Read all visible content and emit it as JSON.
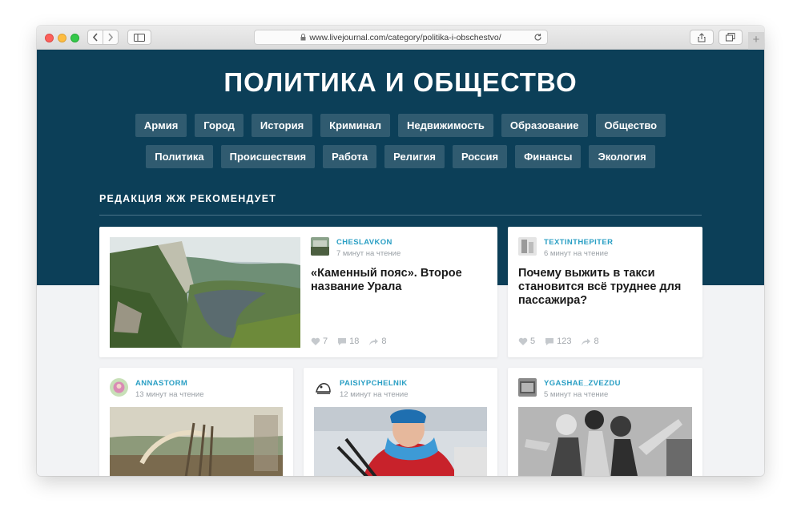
{
  "browser": {
    "url": "www.livejournal.com/category/politika-i-obschestvo/"
  },
  "page": {
    "title": "ПОЛИТИКА И ОБЩЕСТВО",
    "tags_row1": [
      "Армия",
      "Город",
      "История",
      "Криминал",
      "Недвижимость",
      "Образование",
      "Общество"
    ],
    "tags_row2": [
      "Политика",
      "Происшествия",
      "Работа",
      "Религия",
      "Россия",
      "Финансы",
      "Экология"
    ],
    "section_title": "РЕДАКЦИЯ ЖЖ РЕКОМЕНДУЕТ"
  },
  "featured": [
    {
      "author": "CHESLAVKON",
      "read_time": "7 минут на чтение",
      "headline_l1": "«Каменный пояс». Второе",
      "headline_l2": "название Урала",
      "likes": "7",
      "comments": "18",
      "reposts": "8"
    },
    {
      "author": "TEXTINTHEPITER",
      "read_time": "6 минут на чтение",
      "headline_l1": "Почему выжить в такси",
      "headline_l2": "становится всё труднее для",
      "headline_l3": "пассажира?",
      "likes": "5",
      "comments": "123",
      "reposts": "8"
    }
  ],
  "posts": [
    {
      "author": "ANNASTORM",
      "read_time": "13 минут на чтение"
    },
    {
      "author": "PAISIYPCHELNIK",
      "read_time": "12 минут на чтение"
    },
    {
      "author": "YGASHAE_ZVEZDU",
      "read_time": "5 минут на чтение"
    }
  ],
  "colors": {
    "header_bg": "#0c3f58",
    "tag_bg": "#305b70",
    "author_link": "#2a9fc4"
  }
}
